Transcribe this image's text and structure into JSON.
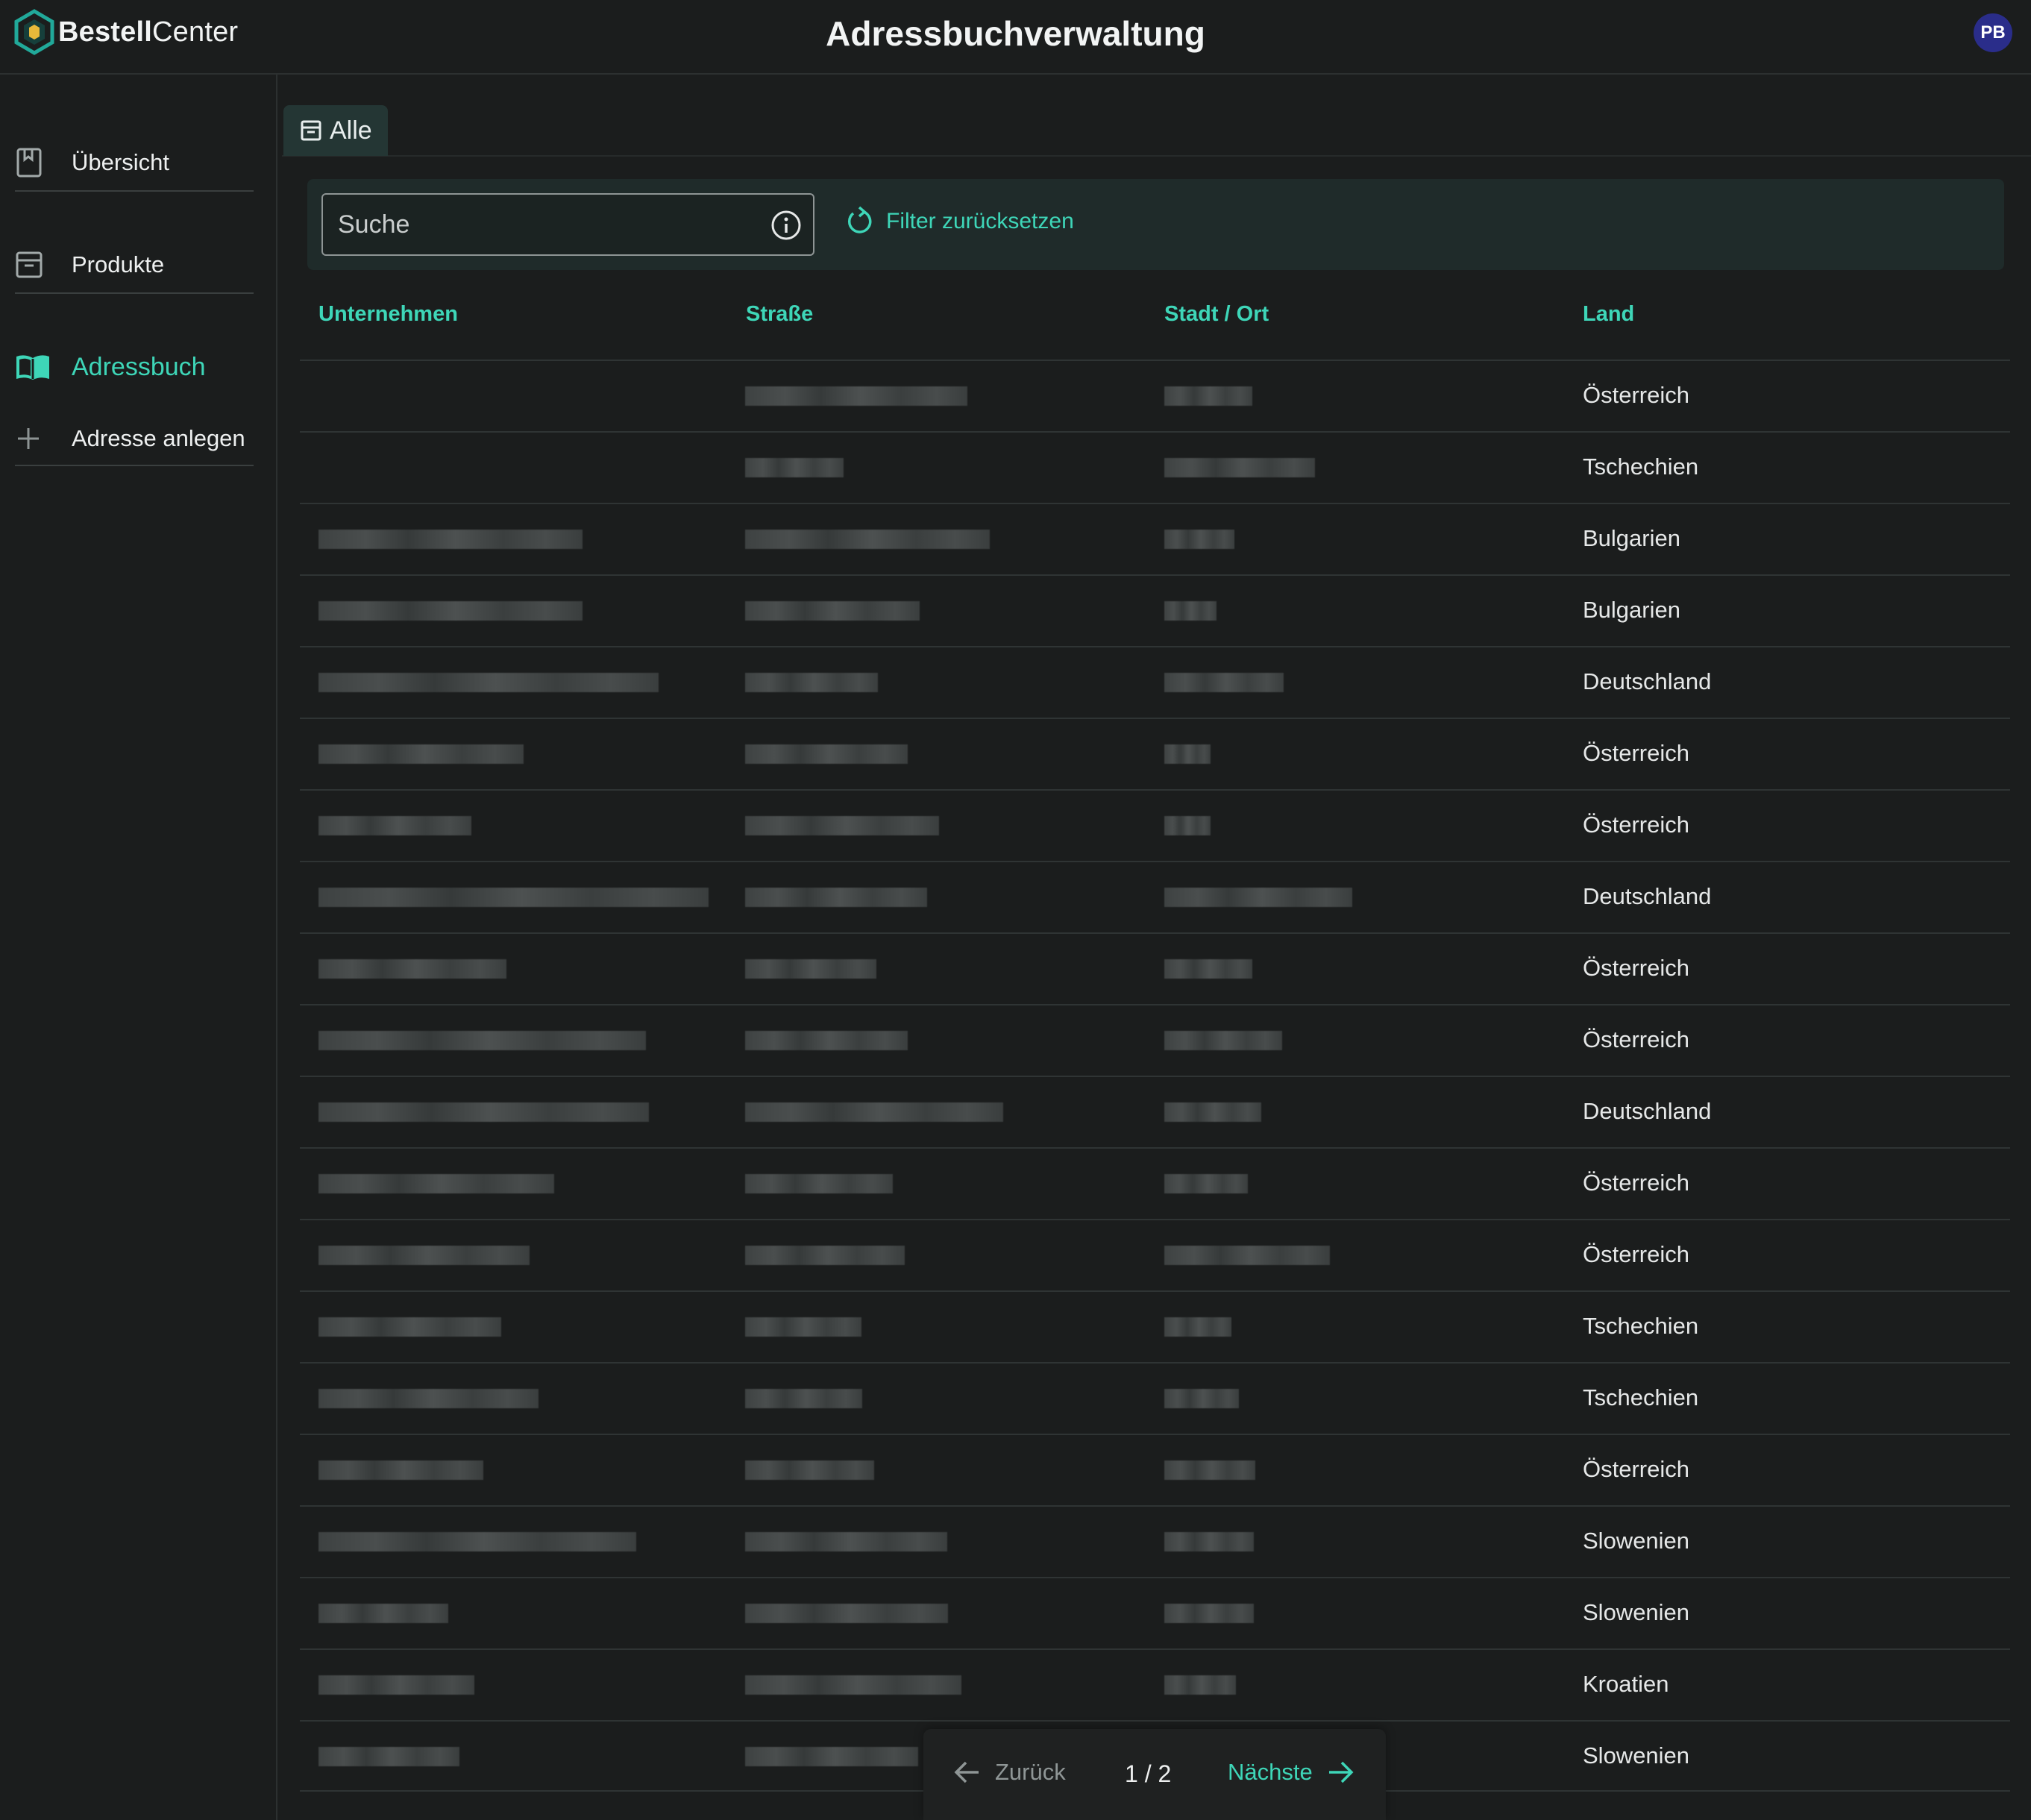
{
  "app": {
    "brand_bold": "Bestell",
    "brand_rest": "Center",
    "title": "Adressbuchverwaltung",
    "user_initials": "PB"
  },
  "sidebar": {
    "items": [
      {
        "label": "Übersicht",
        "icon": "bookmark-icon"
      },
      {
        "label": "Produkte",
        "icon": "archive-icon"
      },
      {
        "label": "Adressbuch",
        "icon": "open-book-icon",
        "active": true
      },
      {
        "label": "Adresse anlegen",
        "icon": "plus-icon"
      }
    ]
  },
  "tabs": [
    {
      "label": "Alle",
      "icon": "archive-icon"
    }
  ],
  "filter": {
    "search_placeholder": "Suche",
    "reset_label": "Filter zurücksetzen"
  },
  "table": {
    "headers": {
      "company": "Unternehmen",
      "street": "Straße",
      "city": "Stadt / Ort",
      "country": "Land"
    },
    "rows": [
      {
        "land": "Österreich"
      },
      {
        "land": "Tschechien"
      },
      {
        "land": "Bulgarien"
      },
      {
        "land": "Bulgarien"
      },
      {
        "land": "Deutschland"
      },
      {
        "land": "Österreich"
      },
      {
        "land": "Österreich"
      },
      {
        "land": "Deutschland"
      },
      {
        "land": "Österreich"
      },
      {
        "land": "Österreich"
      },
      {
        "land": "Deutschland"
      },
      {
        "land": "Österreich"
      },
      {
        "land": "Österreich"
      },
      {
        "land": "Tschechien"
      },
      {
        "land": "Tschechien"
      },
      {
        "land": "Österreich"
      },
      {
        "land": "Slowenien"
      },
      {
        "land": "Slowenien"
      },
      {
        "land": "Kroatien"
      },
      {
        "land": "Slowenien"
      }
    ]
  },
  "pagination": {
    "prev_label": "Zurück",
    "page": "1 / 2",
    "next_label": "Nächste"
  },
  "colors": {
    "accent": "#3ed6b8",
    "background": "#1b1d1d",
    "avatar": "#2a2d8a"
  }
}
